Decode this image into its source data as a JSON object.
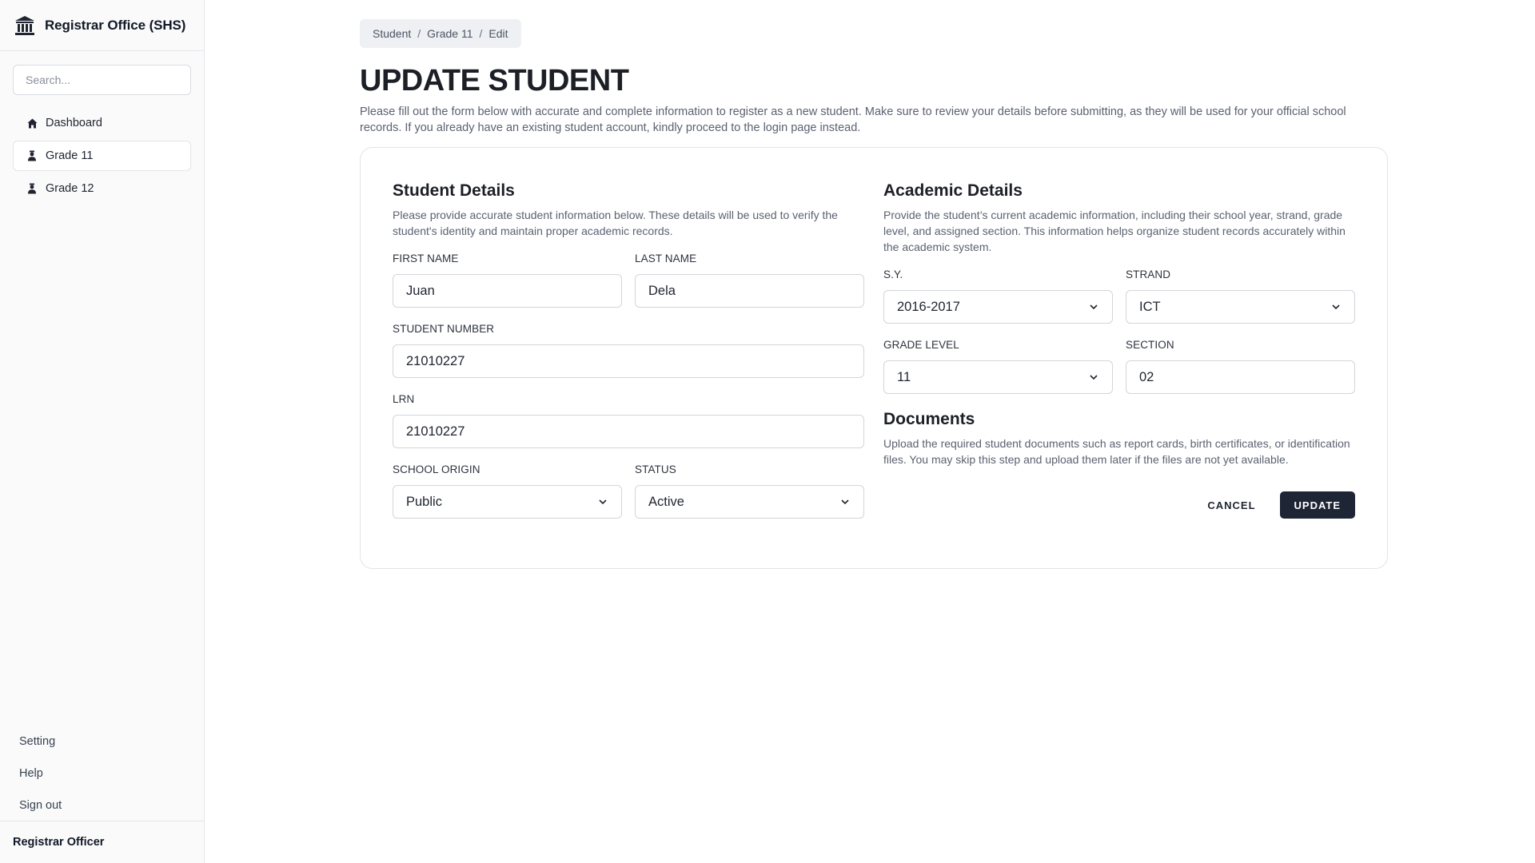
{
  "sidebar": {
    "brand": {
      "title": "Registrar Office (SHS)",
      "icon": "bank-icon"
    },
    "search": {
      "placeholder": "Search...",
      "value": ""
    },
    "nav": [
      {
        "label": "Dashboard",
        "icon": "home-icon",
        "active": false
      },
      {
        "label": "Grade 11",
        "icon": "student-icon",
        "active": true
      },
      {
        "label": "Grade 12",
        "icon": "student-icon",
        "active": false
      }
    ],
    "bottom_links": [
      "Setting",
      "Help",
      "Sign out"
    ],
    "footer": {
      "user": "Registrar Officer"
    }
  },
  "breadcrumb": [
    "Student",
    "Grade 11",
    "Edit"
  ],
  "page": {
    "title": "UPDATE STUDENT",
    "description": "Please fill out the form below with accurate and complete information to register as a new student. Make sure to review your details before submitting, as they will be used for your official school records. If you already have an existing student account, kindly proceed to the login page instead."
  },
  "student_details": {
    "title": "Student Details",
    "description": "Please provide accurate student information below. These details will be used to verify the student's identity and maintain proper academic records.",
    "first_name": {
      "label": "FIRST NAME",
      "value": "Juan"
    },
    "last_name": {
      "label": "LAST NAME",
      "value": "Dela"
    },
    "student_number": {
      "label": "STUDENT NUMBER",
      "value": "21010227"
    },
    "lrn": {
      "label": "LRN",
      "value": "21010227"
    },
    "school_origin": {
      "label": "SCHOOL ORIGIN",
      "value": "Public"
    },
    "status": {
      "label": "STATUS",
      "value": "Active"
    }
  },
  "academic_details": {
    "title": "Academic Details",
    "description": "Provide the student’s current academic information, including their school year, strand, grade level, and assigned section. This information helps organize student records accurately within the academic system.",
    "sy": {
      "label": "S.Y.",
      "value": "2016-2017"
    },
    "strand": {
      "label": "STRAND",
      "value": "ICT"
    },
    "grade_level": {
      "label": "GRADE LEVEL",
      "value": "11"
    },
    "section": {
      "label": "SECTION",
      "value": "02"
    }
  },
  "documents": {
    "title": "Documents",
    "description": "Upload the required student documents such as report cards, birth certificates, or identification files. You may skip this step and upload them later if the files are not yet available."
  },
  "actions": {
    "cancel": "CANCEL",
    "update": "UPDATE"
  },
  "colors": {
    "primary_button": "#1e2534",
    "border": "#d2d5da",
    "sidebar_bg": "#fafafa"
  }
}
